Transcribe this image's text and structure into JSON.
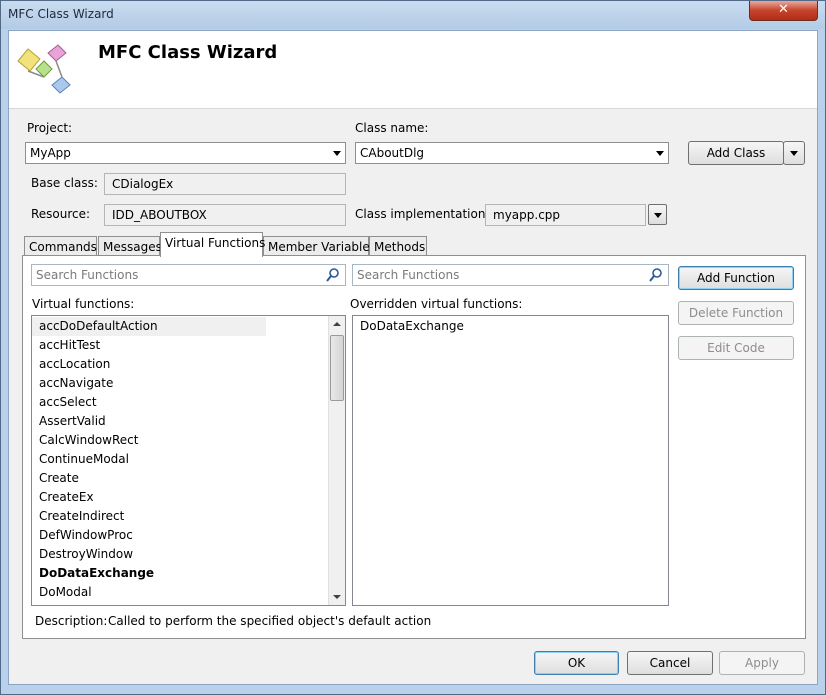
{
  "window": {
    "title": "MFC Class Wizard",
    "close_glyph": "✕"
  },
  "header": {
    "title": "MFC Class Wizard"
  },
  "project": {
    "label": "Project:",
    "value": "MyApp"
  },
  "classname": {
    "label": "Class name:",
    "value": "CAboutDlg"
  },
  "add_class": {
    "label": "Add Class"
  },
  "base_class": {
    "label": "Base class:",
    "value": "CDialogEx"
  },
  "resource": {
    "label": "Resource:",
    "value": "IDD_ABOUTBOX"
  },
  "class_impl": {
    "label": "Class implementation:",
    "value": "myapp.cpp"
  },
  "tabs": [
    {
      "label": "Commands"
    },
    {
      "label": "Messages"
    },
    {
      "label": "Virtual Functions"
    },
    {
      "label": "Member Variables"
    },
    {
      "label": "Methods"
    }
  ],
  "search_left": {
    "placeholder": "Search Functions"
  },
  "search_right": {
    "placeholder": "Search Functions"
  },
  "virtual_functions": {
    "label": "Virtual functions:",
    "items": [
      "accDoDefaultAction",
      "accHitTest",
      "accLocation",
      "accNavigate",
      "accSelect",
      "AssertValid",
      "CalcWindowRect",
      "ContinueModal",
      "Create",
      "CreateEx",
      "CreateIndirect",
      "DefWindowProc",
      "DestroyWindow",
      "DoDataExchange",
      "DoModal"
    ]
  },
  "overridden": {
    "label": "Overridden virtual functions:",
    "items": [
      "DoDataExchange"
    ]
  },
  "buttons": {
    "add_function": "Add Function",
    "delete_function": "Delete Function",
    "edit_code": "Edit Code",
    "ok": "OK",
    "cancel": "Cancel",
    "apply": "Apply"
  },
  "description": {
    "label": "Description:",
    "text": "Called to perform the specified object's default action"
  }
}
